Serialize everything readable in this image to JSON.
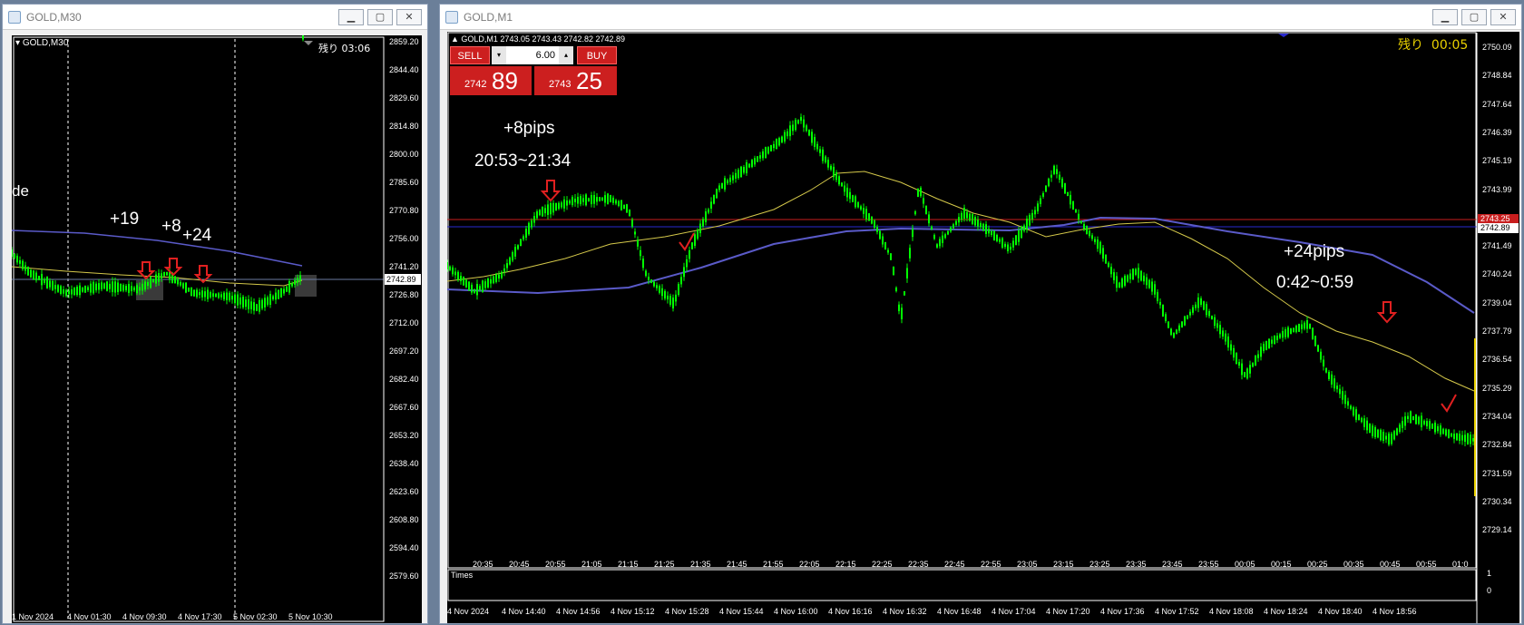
{
  "left_window": {
    "title": "GOLD,M30",
    "header": "GOLD,M30",
    "timer": "残り 03:06",
    "partial_label": "de",
    "annotations": [
      "+19",
      "+8",
      "+24"
    ],
    "price_scale": [
      "2859.20",
      "2844.40",
      "2829.60",
      "2814.80",
      "2800.00",
      "2785.60",
      "2770.80",
      "2756.00",
      "2741.20",
      "2726.80",
      "2712.00",
      "2697.20",
      "2682.40",
      "2667.60",
      "2653.20",
      "2638.40",
      "2623.60",
      "2608.80",
      "2594.40",
      "2579.60"
    ],
    "current_price": "2742.89",
    "time_labels": [
      "1 Nov 2024",
      "4 Nov 01:30",
      "4 Nov 09:30",
      "4 Nov 17:30",
      "5 Nov 02:30",
      "5 Nov 10:30"
    ]
  },
  "right_window": {
    "title": "GOLD,M1",
    "header": "GOLD,M1  2743.05 2743.43 2742.82 2742.89",
    "timer_label": "残り",
    "timer_value": "00:05",
    "trade_panel": {
      "sell_label": "SELL",
      "buy_label": "BUY",
      "lot": "6.00",
      "sell_big": "2742",
      "sell_small": "89",
      "buy_big": "2743",
      "buy_small": "25"
    },
    "annotation_1": {
      "pips": "+8pips",
      "time": "20:53~21:34"
    },
    "annotation_2": {
      "pips": "+24pips",
      "time": "0:42~0:59"
    },
    "price_scale": [
      "2750.09",
      "2748.84",
      "2747.64",
      "2746.39",
      "2745.19",
      "2743.99",
      "2742.89",
      "2741.49",
      "2740.24",
      "2739.04",
      "2737.79",
      "2736.54",
      "2735.29",
      "2734.04",
      "2732.84",
      "2731.59",
      "2730.34",
      "2729.14"
    ],
    "red_price": "2743.25",
    "current_price": "2742.89",
    "indicator_label": "Times",
    "indicator_scale": [
      "1",
      "0"
    ],
    "time_labels_top": [
      "20:35",
      "20:45",
      "20:55",
      "21:05",
      "21:15",
      "21:25",
      "21:35",
      "21:45",
      "21:55",
      "22:05",
      "22:15",
      "22:25",
      "22:35",
      "22:45",
      "22:55",
      "23:05",
      "23:15",
      "23:25",
      "23:35",
      "23:45",
      "23:55",
      "00:05",
      "00:15",
      "00:25",
      "00:35",
      "00:45",
      "00:55",
      "01:0"
    ],
    "time_labels_bottom": [
      "4 Nov 2024",
      "4 Nov 14:40",
      "4 Nov 14:56",
      "4 Nov 15:12",
      "4 Nov 15:28",
      "4 Nov 15:44",
      "4 Nov 16:00",
      "4 Nov 16:16",
      "4 Nov 16:32",
      "4 Nov 16:48",
      "4 Nov 17:04",
      "4 Nov 17:20",
      "4 Nov 17:36",
      "4 Nov 17:52",
      "4 Nov 18:08",
      "4 Nov 18:24",
      "4 Nov 18:40",
      "4 Nov 18:56"
    ]
  },
  "colors": {
    "candles": "#00ff00",
    "ma_fast": "#d4c84a",
    "ma_slow": "#5a5ac8",
    "arrow": "#e02020",
    "red_line": "#c81e1e",
    "blue_line": "#2a2ad0"
  }
}
